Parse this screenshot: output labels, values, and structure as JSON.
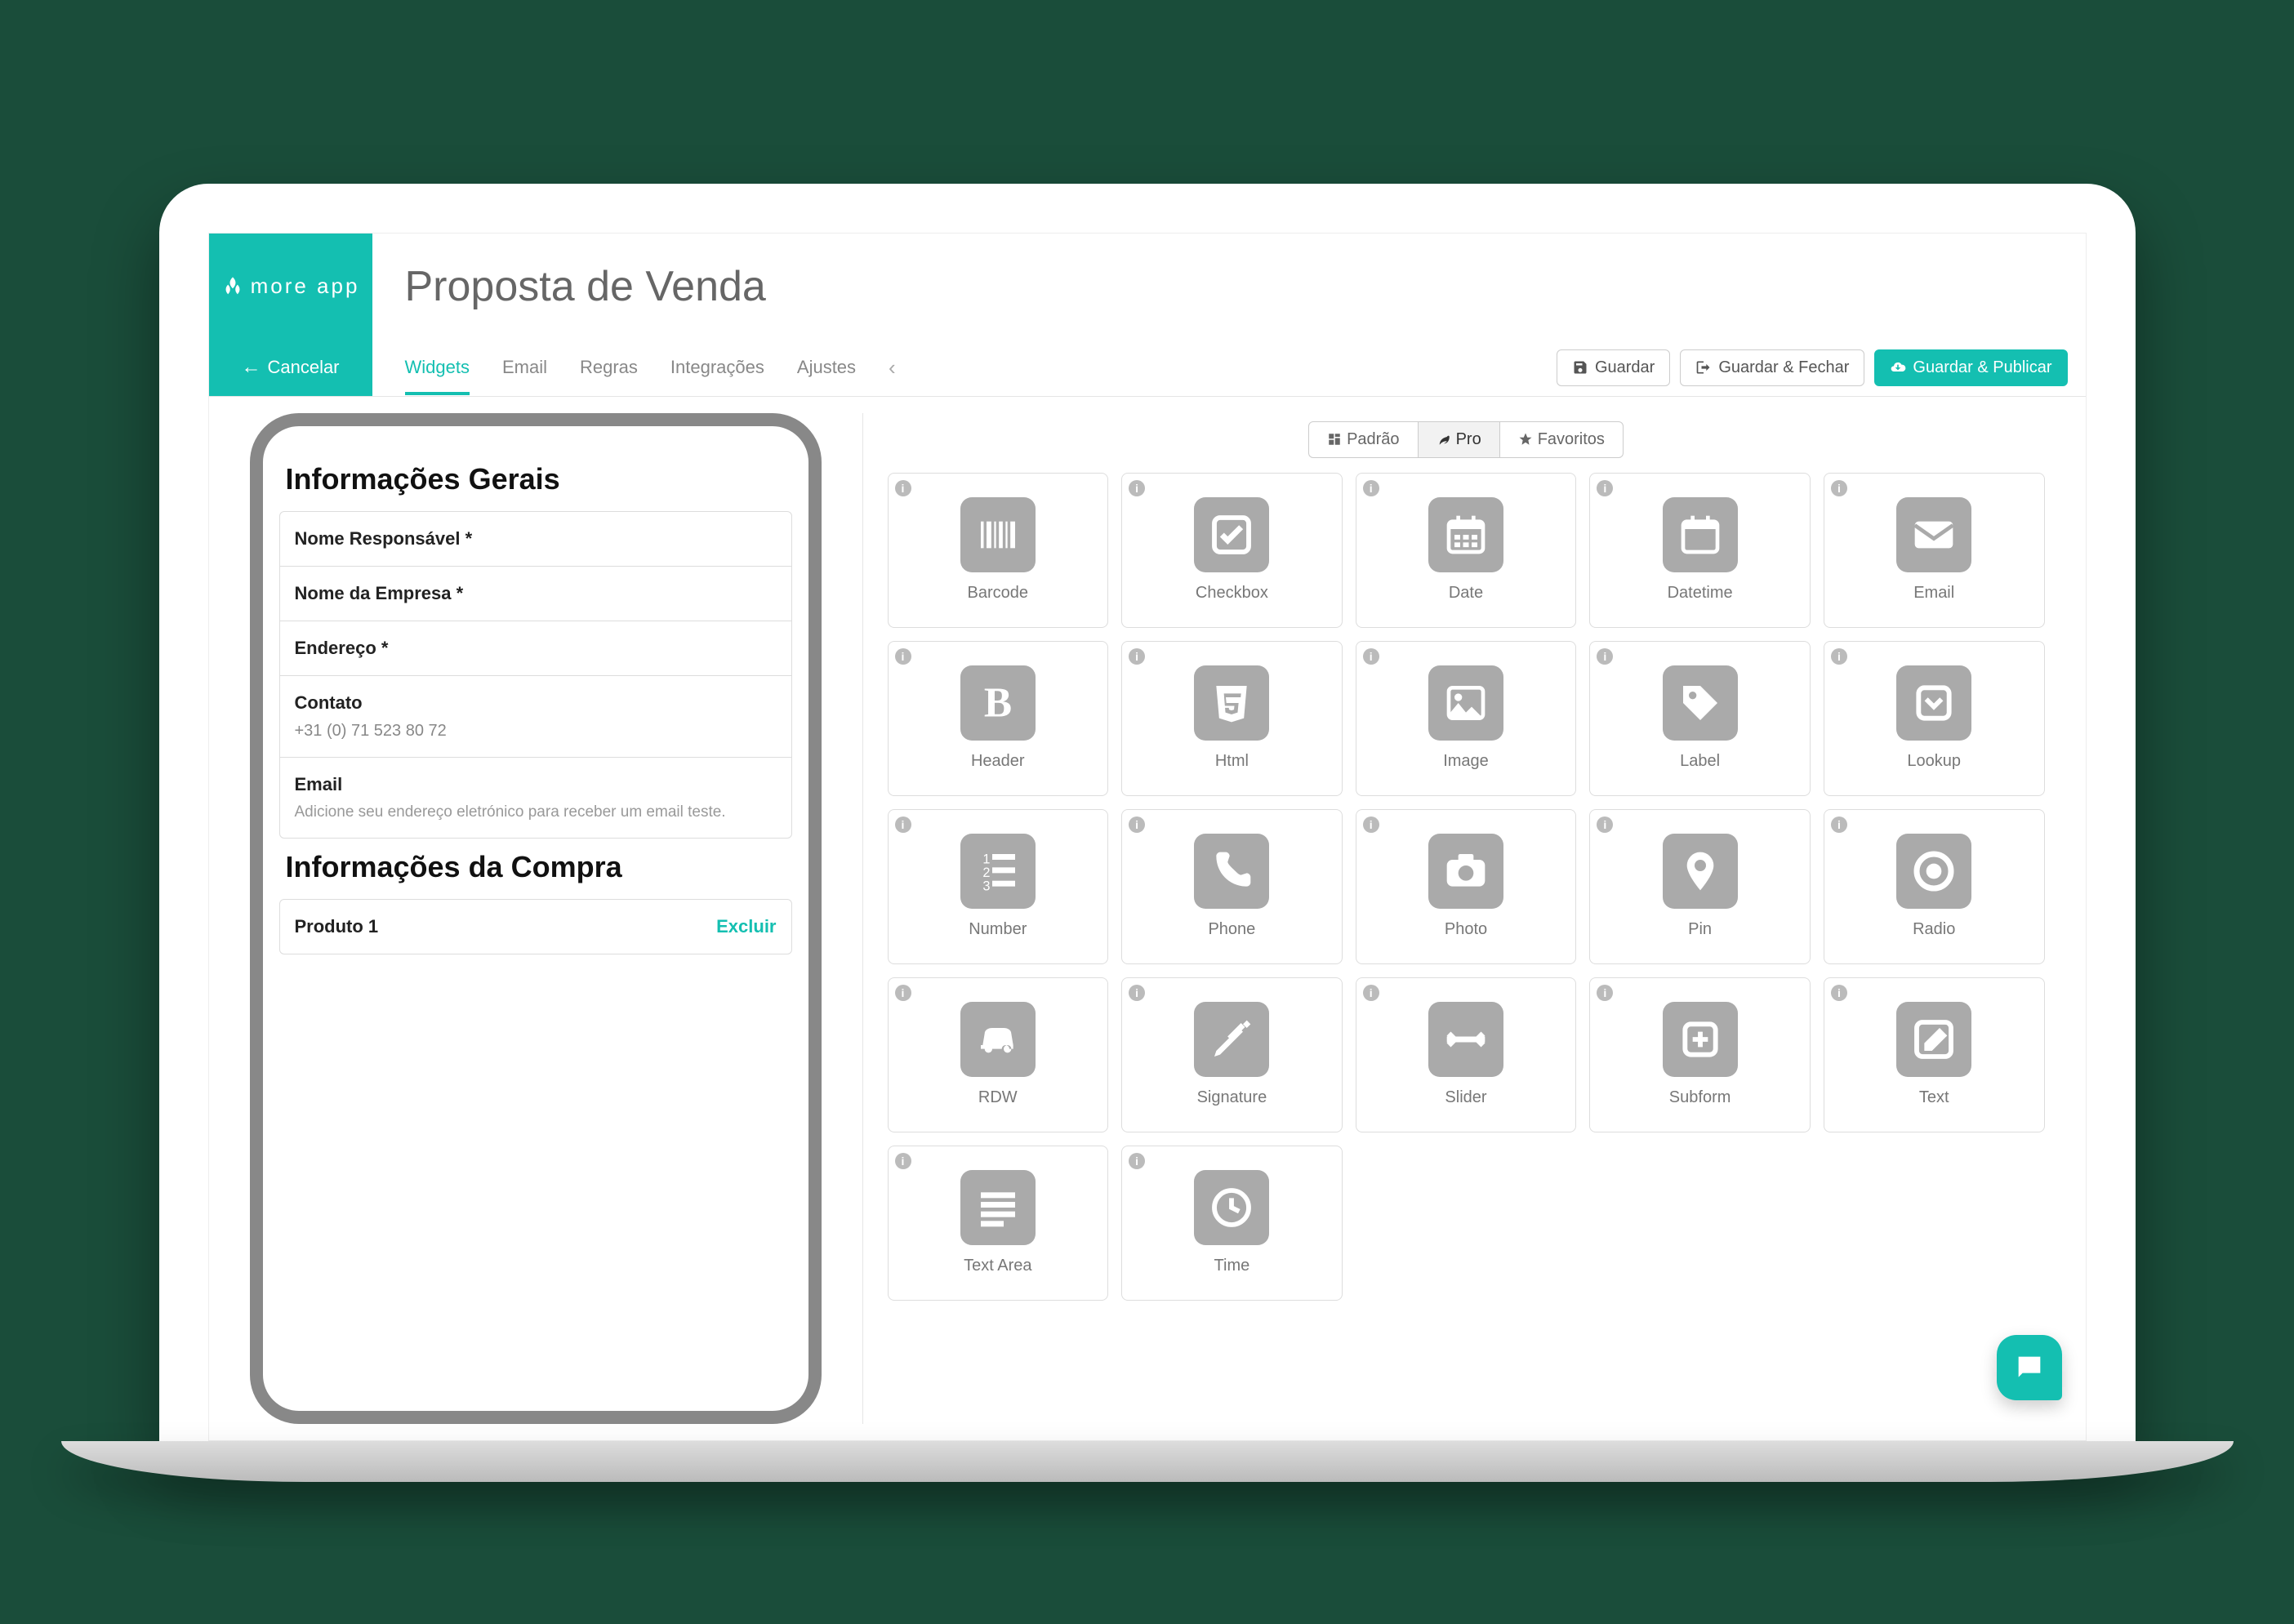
{
  "brand": {
    "name": "more app"
  },
  "page_title": "Proposta de Venda",
  "cancel_label": "Cancelar",
  "tabs": {
    "widgets": "Widgets",
    "email": "Email",
    "regras": "Regras",
    "integracoes": "Integrações",
    "ajustes": "Ajustes"
  },
  "actions": {
    "save": "Guardar",
    "save_close": "Guardar & Fechar",
    "save_publish": "Guardar & Publicar"
  },
  "preview": {
    "section1_title": "Informações Gerais",
    "fields": {
      "responsavel": "Nome Responsável *",
      "empresa": "Nome da Empresa *",
      "endereco": "Endereço *",
      "contato_label": "Contato",
      "contato_value": "+31 (0) 71 523 80 72",
      "email_label": "Email",
      "email_hint": "Adicione seu endereço eletrónico para receber um email teste."
    },
    "section2_title": "Informações da Compra",
    "product_name": "Produto 1",
    "product_delete": "Excluir"
  },
  "widget_tabs": {
    "padrao": "Padrão",
    "pro": "Pro",
    "favoritos": "Favoritos"
  },
  "widgets": [
    {
      "id": "barcode",
      "label": "Barcode"
    },
    {
      "id": "checkbox",
      "label": "Checkbox"
    },
    {
      "id": "date",
      "label": "Date"
    },
    {
      "id": "datetime",
      "label": "Datetime"
    },
    {
      "id": "email",
      "label": "Email"
    },
    {
      "id": "header",
      "label": "Header"
    },
    {
      "id": "html",
      "label": "Html"
    },
    {
      "id": "image",
      "label": "Image"
    },
    {
      "id": "label",
      "label": "Label"
    },
    {
      "id": "lookup",
      "label": "Lookup"
    },
    {
      "id": "number",
      "label": "Number"
    },
    {
      "id": "phone",
      "label": "Phone"
    },
    {
      "id": "photo",
      "label": "Photo"
    },
    {
      "id": "pin",
      "label": "Pin"
    },
    {
      "id": "radio",
      "label": "Radio"
    },
    {
      "id": "rdw",
      "label": "RDW"
    },
    {
      "id": "signature",
      "label": "Signature"
    },
    {
      "id": "slider",
      "label": "Slider"
    },
    {
      "id": "subform",
      "label": "Subform"
    },
    {
      "id": "text",
      "label": "Text"
    },
    {
      "id": "textarea",
      "label": "Text Area"
    },
    {
      "id": "time",
      "label": "Time"
    }
  ]
}
